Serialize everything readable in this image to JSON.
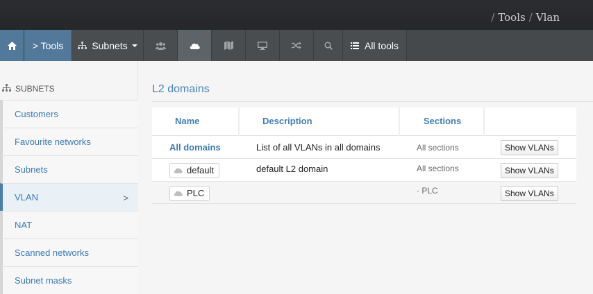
{
  "breadcrumb": {
    "sep": "/",
    "items": [
      "Tools",
      "Vlan"
    ]
  },
  "nav": {
    "home_icon": "home-icon",
    "tools_label": "> Tools",
    "subnets_label": "Subnets",
    "icons": [
      "users-icon",
      "cloud-icon",
      "map-icon",
      "monitor-icon",
      "shuffle-icon",
      "search-icon"
    ],
    "all_tools_label": "All tools"
  },
  "sidebar": {
    "heading": "SUBNETS",
    "items": [
      {
        "label": "Customers"
      },
      {
        "label": "Favourite networks"
      },
      {
        "label": "Subnets"
      },
      {
        "label": "VLAN",
        "active": true,
        "chevron": ">"
      },
      {
        "label": "NAT"
      },
      {
        "label": "Scanned networks"
      },
      {
        "label": "Subnet masks"
      }
    ]
  },
  "main": {
    "title": "L2 domains",
    "table": {
      "headers": [
        "Name",
        "Description",
        "Sections",
        ""
      ],
      "rows": [
        {
          "name": "All domains",
          "description": "List of all VLANs in all domains",
          "sections": "All sections",
          "action": "Show VLANs"
        },
        {
          "name": "default",
          "description": "default L2 domain",
          "sections": "All sections",
          "action": "Show VLANs"
        },
        {
          "name": "PLC",
          "description": "",
          "sections": "· PLC",
          "action": "Show VLANs"
        }
      ]
    }
  },
  "colors": {
    "accent": "#52799a",
    "link": "#3a7bb4",
    "navbar": "#46494c",
    "topbar": "#2b2d30"
  }
}
